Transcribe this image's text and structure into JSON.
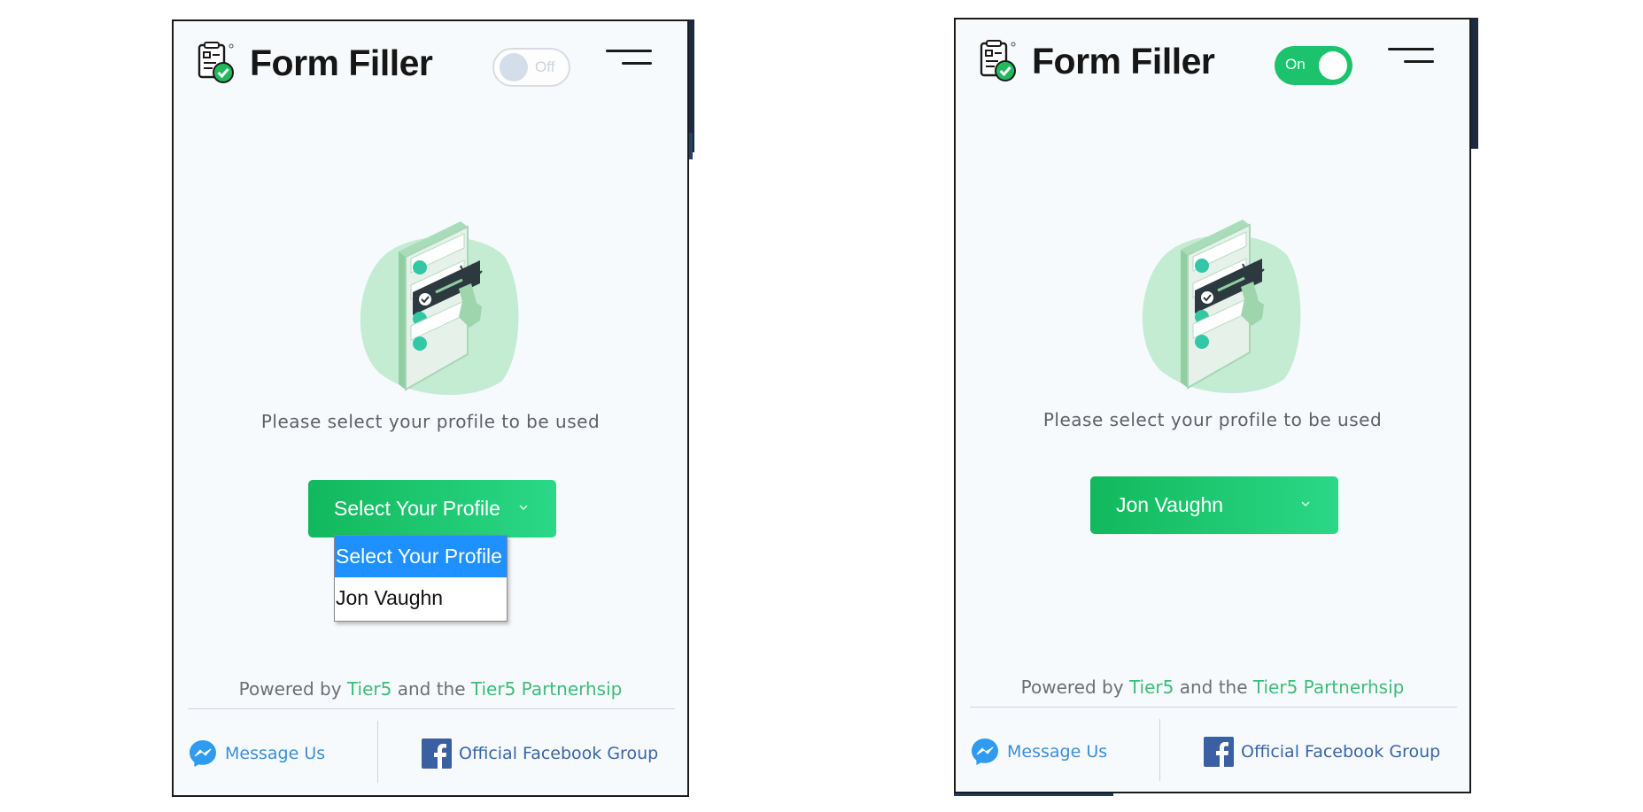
{
  "app": {
    "title": "Form Filler"
  },
  "panels": [
    {
      "toggle_label": "Off",
      "prompt": "Please select your profile to be used",
      "select_value": "Select Your Profile",
      "dropdown_options": [
        "Select Your Profile",
        "Jon Vaughn"
      ],
      "dropdown_highlighted": "Select Your Profile",
      "powered": {
        "prefix": "Powered by",
        "tier5": "Tier5",
        "mid": "and the",
        "partnership": "Tier5 Partnerhsip"
      },
      "footer": {
        "message": "Message Us",
        "facebook": "Official Facebook Group"
      }
    },
    {
      "toggle_label": "On",
      "prompt": "Please select your profile to be used",
      "select_value": "Jon Vaughn",
      "powered": {
        "prefix": "Powered by",
        "tier5": "Tier5",
        "mid": "and the",
        "partnership": "Tier5 Partnerhsip"
      },
      "footer": {
        "message": "Message Us",
        "facebook": "Official Facebook Group"
      }
    }
  ],
  "colors": {
    "accent_green": "#1cc36c",
    "link_green": "#3dbd78",
    "messenger_blue": "#3a8fd8",
    "facebook_blue": "#3866a7",
    "dropdown_highlight": "#1e90ff"
  },
  "icons": [
    "form-filler-logo-icon",
    "hamburger-menu-icon",
    "chevron-down-icon",
    "messenger-icon",
    "facebook-icon"
  ]
}
